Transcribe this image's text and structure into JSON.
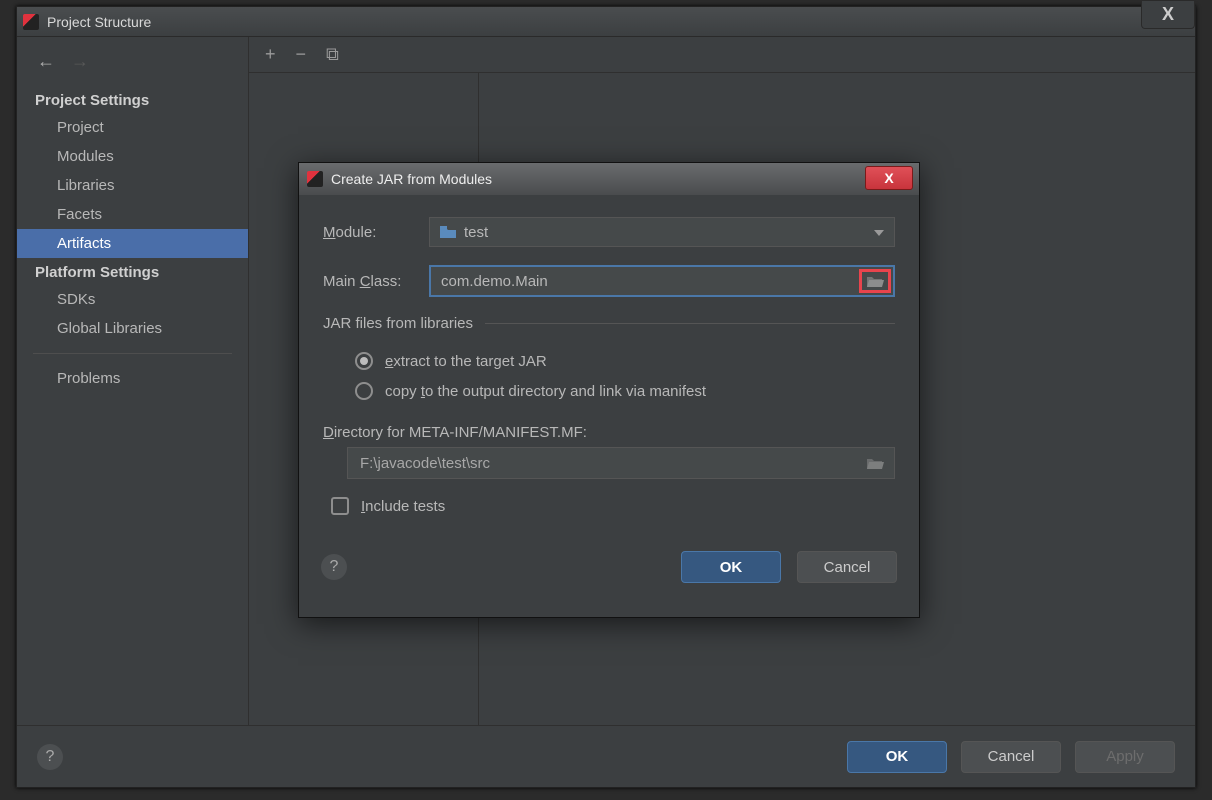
{
  "window": {
    "title": "Project Structure",
    "close": "X"
  },
  "sidebar": {
    "sections": {
      "project_settings": "Project Settings",
      "platform_settings": "Platform Settings"
    },
    "items": {
      "project": "Project",
      "modules": "Modules",
      "libraries": "Libraries",
      "facets": "Facets",
      "artifacts": "Artifacts",
      "sdks": "SDKs",
      "global_libraries": "Global Libraries",
      "problems": "Problems"
    }
  },
  "toolbar": {
    "add": "+",
    "remove": "−",
    "copy": "⧉"
  },
  "footer": {
    "ok": "OK",
    "cancel": "Cancel",
    "apply": "Apply",
    "help": "?"
  },
  "dialog": {
    "title": "Create JAR from Modules",
    "close": "X",
    "module_label": "Module:",
    "module_value": "test",
    "main_class_label": "Main Class:",
    "main_class_value": "com.demo.Main",
    "group_label": "JAR files from libraries",
    "radio_extract": "extract to the target JAR",
    "radio_copy": "copy to the output directory and link via manifest",
    "dir_label": "Directory for META-INF/MANIFEST.MF:",
    "dir_value": "F:\\javacode\\test\\src",
    "include_tests": "Include tests",
    "ok": "OK",
    "cancel": "Cancel",
    "help": "?"
  }
}
